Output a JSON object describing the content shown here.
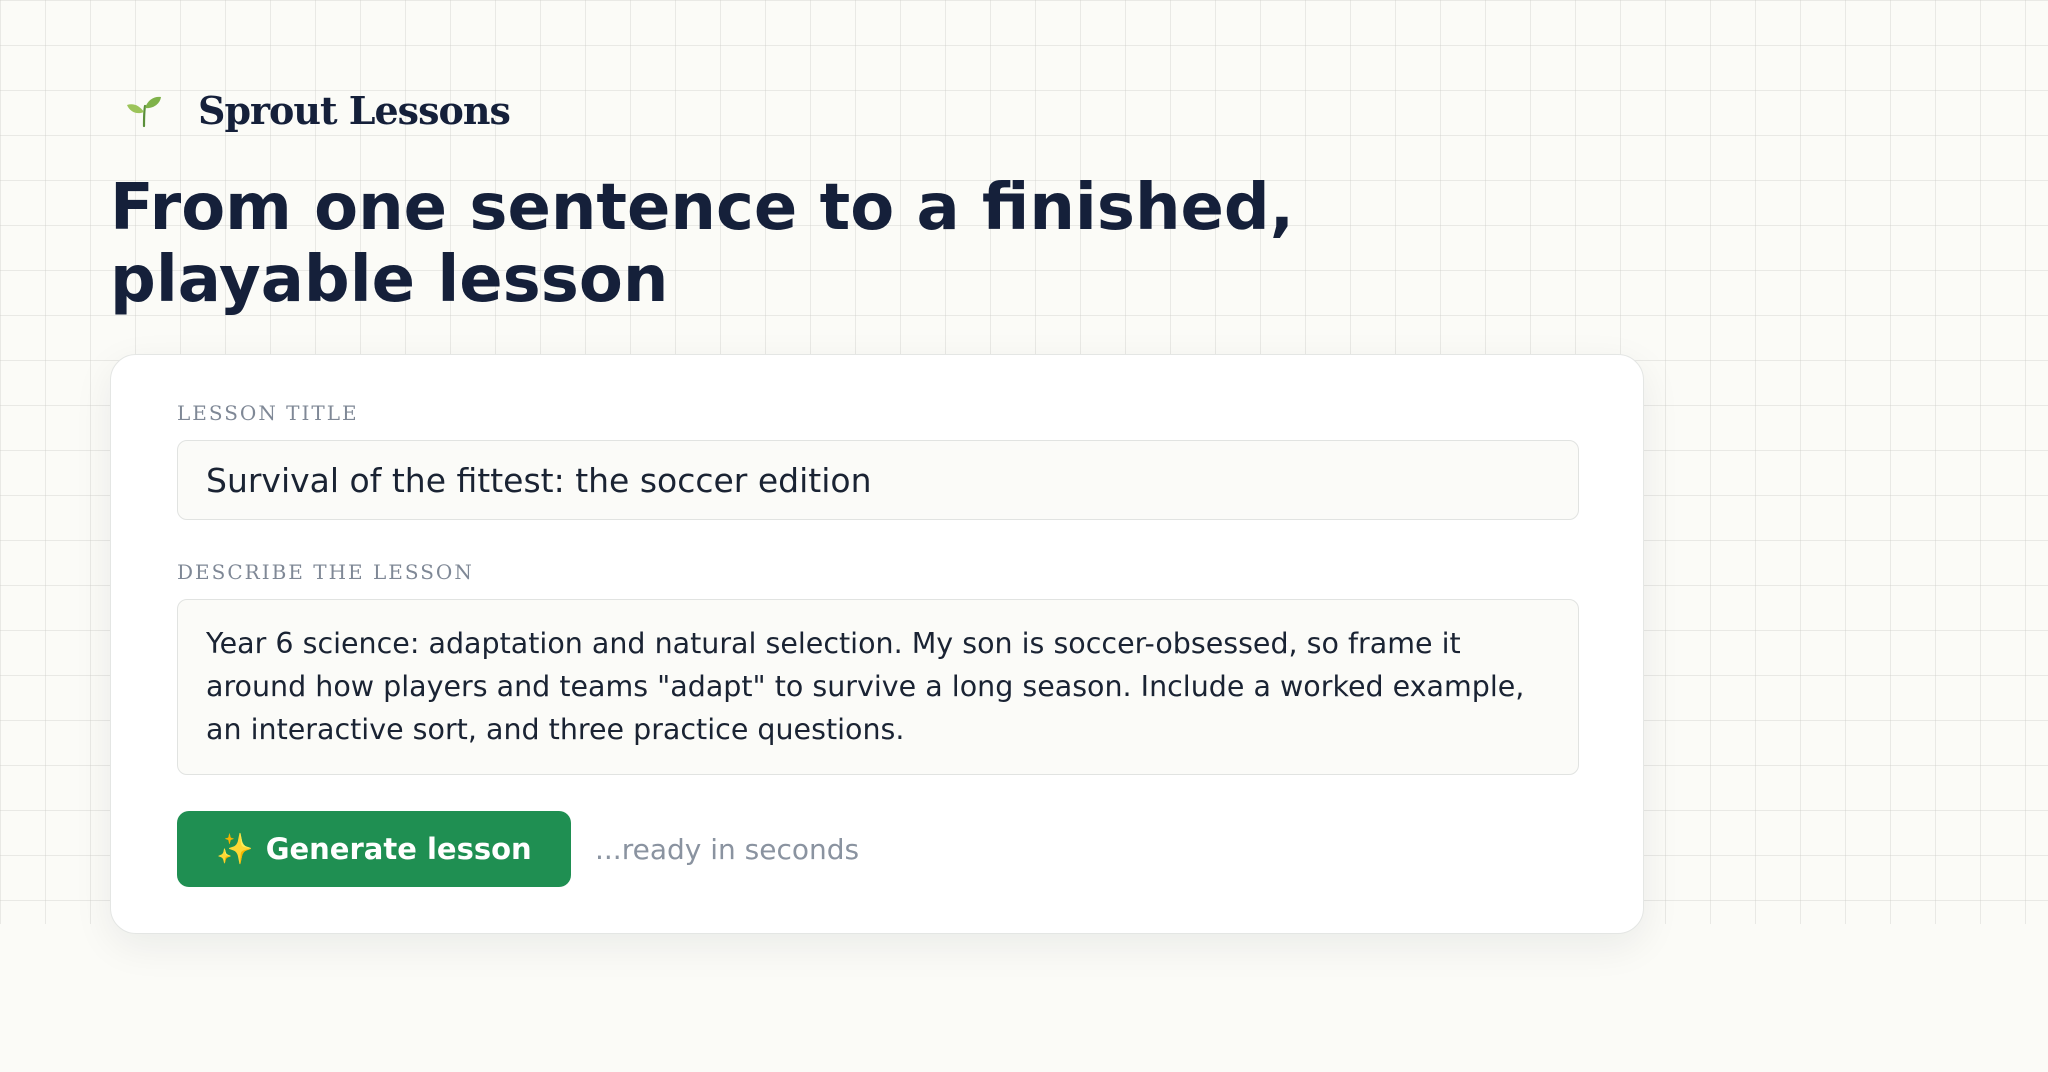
{
  "brand": {
    "icon": "sprout-icon",
    "name": "Sprout Lessons"
  },
  "hero": {
    "headline": "From one sentence to a finished, playable lesson"
  },
  "form": {
    "title_label": "LESSON TITLE",
    "title_value": "Survival of the fittest: the soccer edition",
    "description_label": "DESCRIBE THE LESSON",
    "description_value": "Year 6 science: adaptation and natural selection. My son is soccer-obsessed, so frame it around how players and teams \"adapt\" to survive a long season. Include a worked example, an interactive sort, and three practice questions.",
    "generate_icon": "sparkles-icon",
    "generate_label": "Generate lesson",
    "ready_hint": "...ready in seconds"
  },
  "colors": {
    "accent": "#1f8f52",
    "heading": "#15203a",
    "muted": "#8a93a0"
  }
}
